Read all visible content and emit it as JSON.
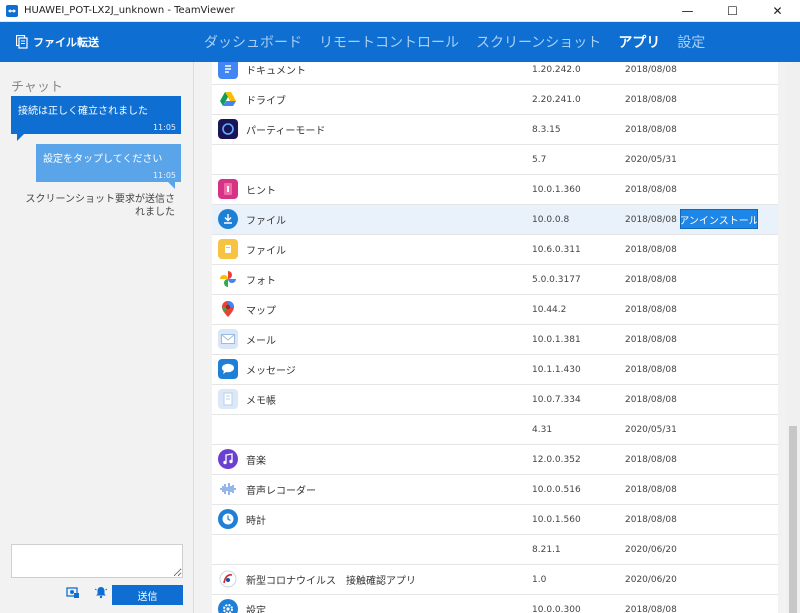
{
  "window": {
    "title": "HUAWEI_POT-LX2J_unknown - TeamViewer",
    "controls": {
      "minimize": "—",
      "maximize": "☐",
      "close": "✕"
    }
  },
  "header": {
    "file_transfer_label": "ファイル転送",
    "tabs": [
      {
        "label": "ダッシュボード",
        "active": false
      },
      {
        "label": "リモートコントロール",
        "active": false
      },
      {
        "label": "スクリーンショット",
        "active": false
      },
      {
        "label": "アプリ",
        "active": true
      },
      {
        "label": "設定",
        "active": false
      }
    ]
  },
  "chat": {
    "title": "チャット",
    "messages": [
      {
        "text": "接続は正しく確立されました",
        "time": "11:05"
      },
      {
        "text": "設定をタップしてください",
        "time": "11:05"
      }
    ],
    "system_message": "スクリーンショット要求が送信されました",
    "input_placeholder": "",
    "send_label": "送信"
  },
  "apps": {
    "uninstall_label": "アンインストール",
    "rows": [
      {
        "name": "ドキュメント",
        "version": "1.20.242.0",
        "date": "2018/08/08",
        "icon": "docs-icon",
        "color": "#4285f4"
      },
      {
        "name": "ドライブ",
        "version": "2.20.241.0",
        "date": "2018/08/08",
        "icon": "drive-icon",
        "color": "#ffffff"
      },
      {
        "name": "パーティーモード",
        "version": "8.3.15",
        "date": "2018/08/08",
        "icon": "party-mode-icon",
        "color": "#1a1457"
      },
      {
        "name": "",
        "version": "5.7",
        "date": "2020/05/31",
        "icon": "",
        "color": ""
      },
      {
        "name": "ヒント",
        "version": "10.0.1.360",
        "date": "2018/08/08",
        "icon": "tips-icon",
        "color": "#d63384"
      },
      {
        "name": "ファイル",
        "version": "10.0.0.8",
        "date": "2018/08/08",
        "icon": "download-icon",
        "color": "#1e7fd6"
      },
      {
        "name": "ファイル",
        "version": "10.6.0.311",
        "date": "2018/08/08",
        "icon": "folder-icon",
        "color": "#f6c343"
      },
      {
        "name": "フォト",
        "version": "5.0.0.3177",
        "date": "2018/08/08",
        "icon": "photos-icon",
        "color": "#ffffff"
      },
      {
        "name": "マップ",
        "version": "10.44.2",
        "date": "2018/08/08",
        "icon": "maps-icon",
        "color": "#ffffff"
      },
      {
        "name": "メール",
        "version": "10.0.1.381",
        "date": "2018/08/08",
        "icon": "mail-icon",
        "color": "#d8e6f7"
      },
      {
        "name": "メッセージ",
        "version": "10.1.1.430",
        "date": "2018/08/08",
        "icon": "messages-icon",
        "color": "#1e7fd6"
      },
      {
        "name": "メモ帳",
        "version": "10.0.7.334",
        "date": "2018/08/08",
        "icon": "notepad-icon",
        "color": "#dbe9f7"
      },
      {
        "name": "",
        "version": "4.31",
        "date": "2020/05/31",
        "icon": "",
        "color": ""
      },
      {
        "name": "音楽",
        "version": "12.0.0.352",
        "date": "2018/08/08",
        "icon": "music-icon",
        "color": "#6a3fd1"
      },
      {
        "name": "音声レコーダー",
        "version": "10.0.0.516",
        "date": "2018/08/08",
        "icon": "recorder-icon",
        "color": "#ffffff"
      },
      {
        "name": "時計",
        "version": "10.0.1.560",
        "date": "2018/08/08",
        "icon": "clock-icon",
        "color": "#1e7fd6"
      },
      {
        "name": "",
        "version": "8.21.1",
        "date": "2020/06/20",
        "icon": "",
        "color": ""
      },
      {
        "name": "新型コロナウイルス　接触確認アプリ",
        "version": "1.0",
        "date": "2020/06/20",
        "icon": "cocoa-icon",
        "color": "#ffffff"
      },
      {
        "name": "設定",
        "version": "10.0.0.300",
        "date": "2018/08/08",
        "icon": "settings-icon",
        "color": "#1e7fd6"
      }
    ]
  },
  "colors": {
    "brand": "#0e6ed1",
    "accent": "#1e86e6"
  }
}
